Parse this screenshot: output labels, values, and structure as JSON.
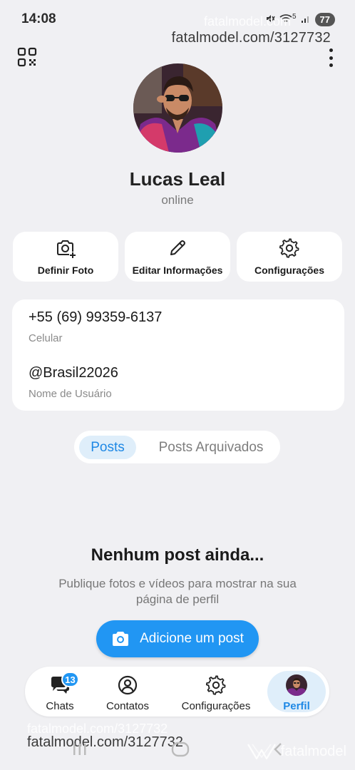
{
  "status_bar": {
    "time": "14:08",
    "wifi_label": "5",
    "battery": "77"
  },
  "watermark": {
    "top_text": "fatalmodel.com/3127732",
    "ghost_top_text": "fatalmodel.com",
    "bottom_text": "fatalmodel.com/3127732",
    "ghost_bottom_text": "fatalmodel.com/3127732",
    "brand": "fatalmodel"
  },
  "top_bar": {
    "qr_icon": "qr-code-icon",
    "menu_icon": "more-vertical-icon"
  },
  "profile": {
    "name": "Lucas Leal",
    "status": "online"
  },
  "actions": [
    {
      "label": "Definir Foto",
      "icon": "camera-plus-icon"
    },
    {
      "label": "Editar Informações",
      "icon": "pencil-icon"
    },
    {
      "label": "Configurações",
      "icon": "gear-icon"
    }
  ],
  "info": {
    "phone": "+55 (69) 99359-6137",
    "phone_label": "Celular",
    "username": "@Brasil22026",
    "username_label": "Nome de Usuário"
  },
  "tabs": {
    "posts": "Posts",
    "archived": "Posts Arquivados",
    "active": "Posts"
  },
  "empty_state": {
    "title": "Nenhum post ainda...",
    "subtitle": "Publique fotos e vídeos para mostrar na sua página de perfil",
    "button": "Adicione um post"
  },
  "bottom_nav": {
    "items": [
      {
        "label": "Chats",
        "icon": "chat-icon",
        "badge": "13"
      },
      {
        "label": "Contatos",
        "icon": "contact-icon"
      },
      {
        "label": "Configurações",
        "icon": "gear-icon"
      },
      {
        "label": "Perfil",
        "icon": "avatar-icon"
      }
    ],
    "active": "Perfil"
  },
  "colors": {
    "accent": "#2196f3",
    "accent_light": "#dfeefa",
    "background": "#f0f0f3",
    "card": "#ffffff"
  }
}
